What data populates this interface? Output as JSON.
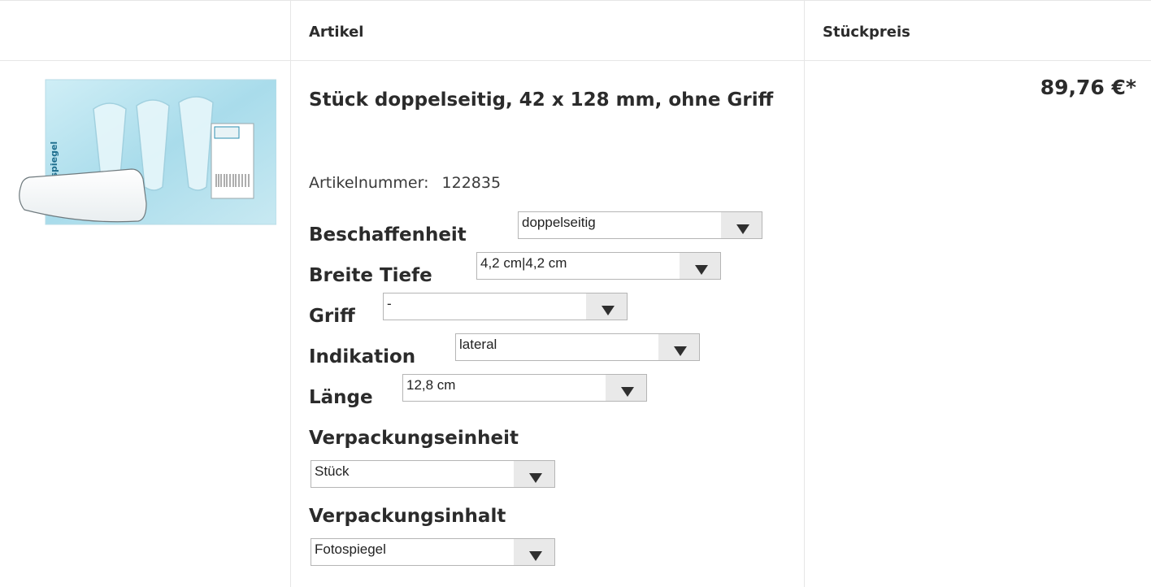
{
  "header": {
    "col_article": "Artikel",
    "col_unit_price": "Stückpreis"
  },
  "product": {
    "title": "Stück doppelseitig, 42 x 128 mm, ohne Griff",
    "article_number_label": "Artikelnummer:",
    "article_number": "122835",
    "price": "89,76 €*",
    "image": {
      "box_text": "Fotospiegel",
      "alt_text": "Fotospiegel package with photo mirror"
    }
  },
  "options": {
    "beschaffenheit": {
      "label": "Beschaffenheit",
      "value": "doppelseitig"
    },
    "breite_tiefe": {
      "label": "Breite Tiefe",
      "value": "4,2 cm|4,2 cm"
    },
    "griff": {
      "label": "Griff",
      "value": "-"
    },
    "indikation": {
      "label": "Indikation",
      "value": "lateral"
    },
    "laenge": {
      "label": "Länge",
      "value": "12,8 cm"
    },
    "verpackungseinheit": {
      "label": "Verpackungseinheit",
      "value": "Stück"
    },
    "verpackungsinhalt": {
      "label": "Verpackungsinhalt",
      "value": "Fotospiegel"
    }
  },
  "icons": {
    "dropdown": "chevron-down-icon"
  },
  "colors": {
    "border": "#e6e6e6",
    "select_arrow_bg": "#e9e9e9",
    "text": "#2b2b2b"
  }
}
